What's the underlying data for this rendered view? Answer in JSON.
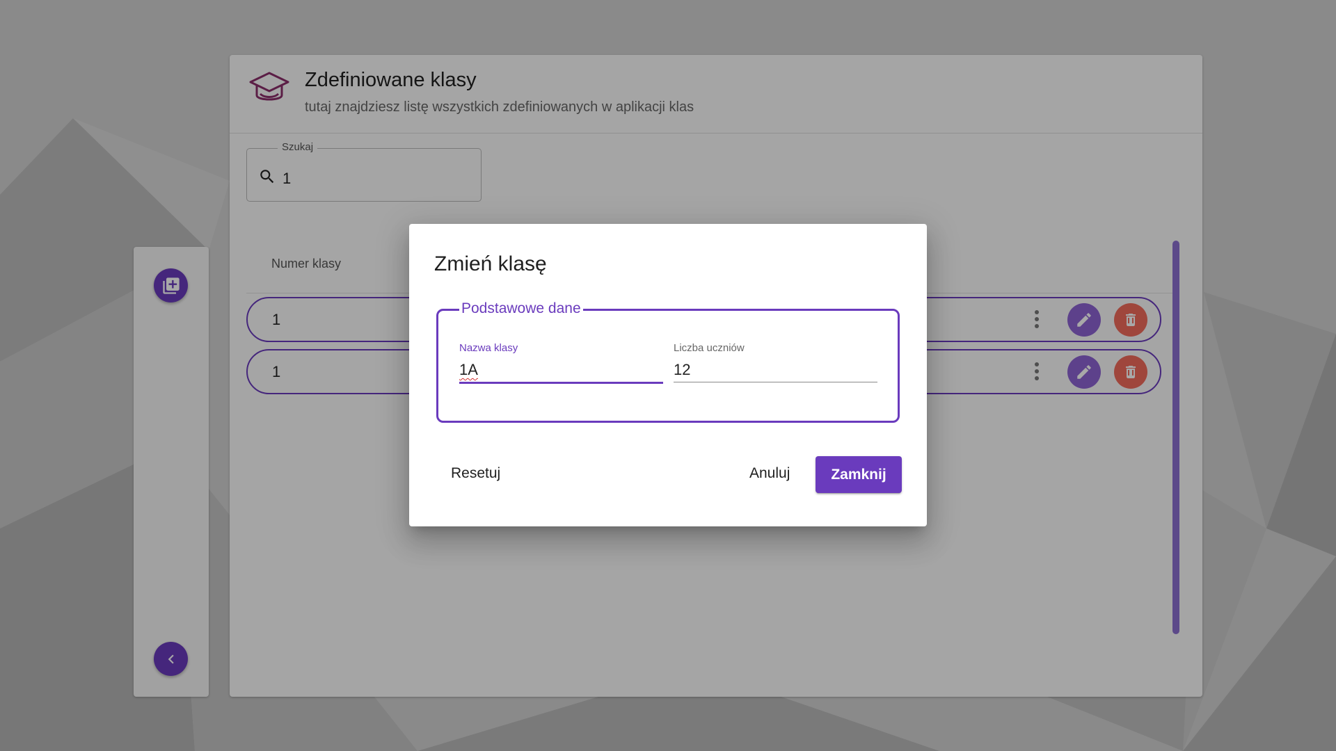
{
  "page": {
    "title": "Zdefiniowane klasy",
    "subtitle": "tutaj znajdziesz listę wszystkich zdefiniowanych w aplikacji klas",
    "header_icon": "graduation-cap-icon"
  },
  "search": {
    "label": "Szukaj",
    "value": "1",
    "icon": "search-icon"
  },
  "table": {
    "column_header": "Numer klasy",
    "rows": [
      {
        "number": "1"
      },
      {
        "number": "1"
      }
    ]
  },
  "sidebar": {
    "add_icon": "add-to-library-icon",
    "back_icon": "chevron-left-icon"
  },
  "dialog": {
    "title": "Zmień klasę",
    "section_legend": "Podstawowe dane",
    "fields": {
      "class_name": {
        "label": "Nazwa klasy",
        "value": "1A"
      },
      "student_count": {
        "label": "Liczba uczniów",
        "value": "12"
      }
    },
    "buttons": {
      "reset": "Resetuj",
      "cancel": "Anuluj",
      "close": "Zamknij"
    }
  },
  "colors": {
    "accent": "#6a3bbd",
    "edit": "#8d63d4",
    "delete": "#f26b5b"
  }
}
